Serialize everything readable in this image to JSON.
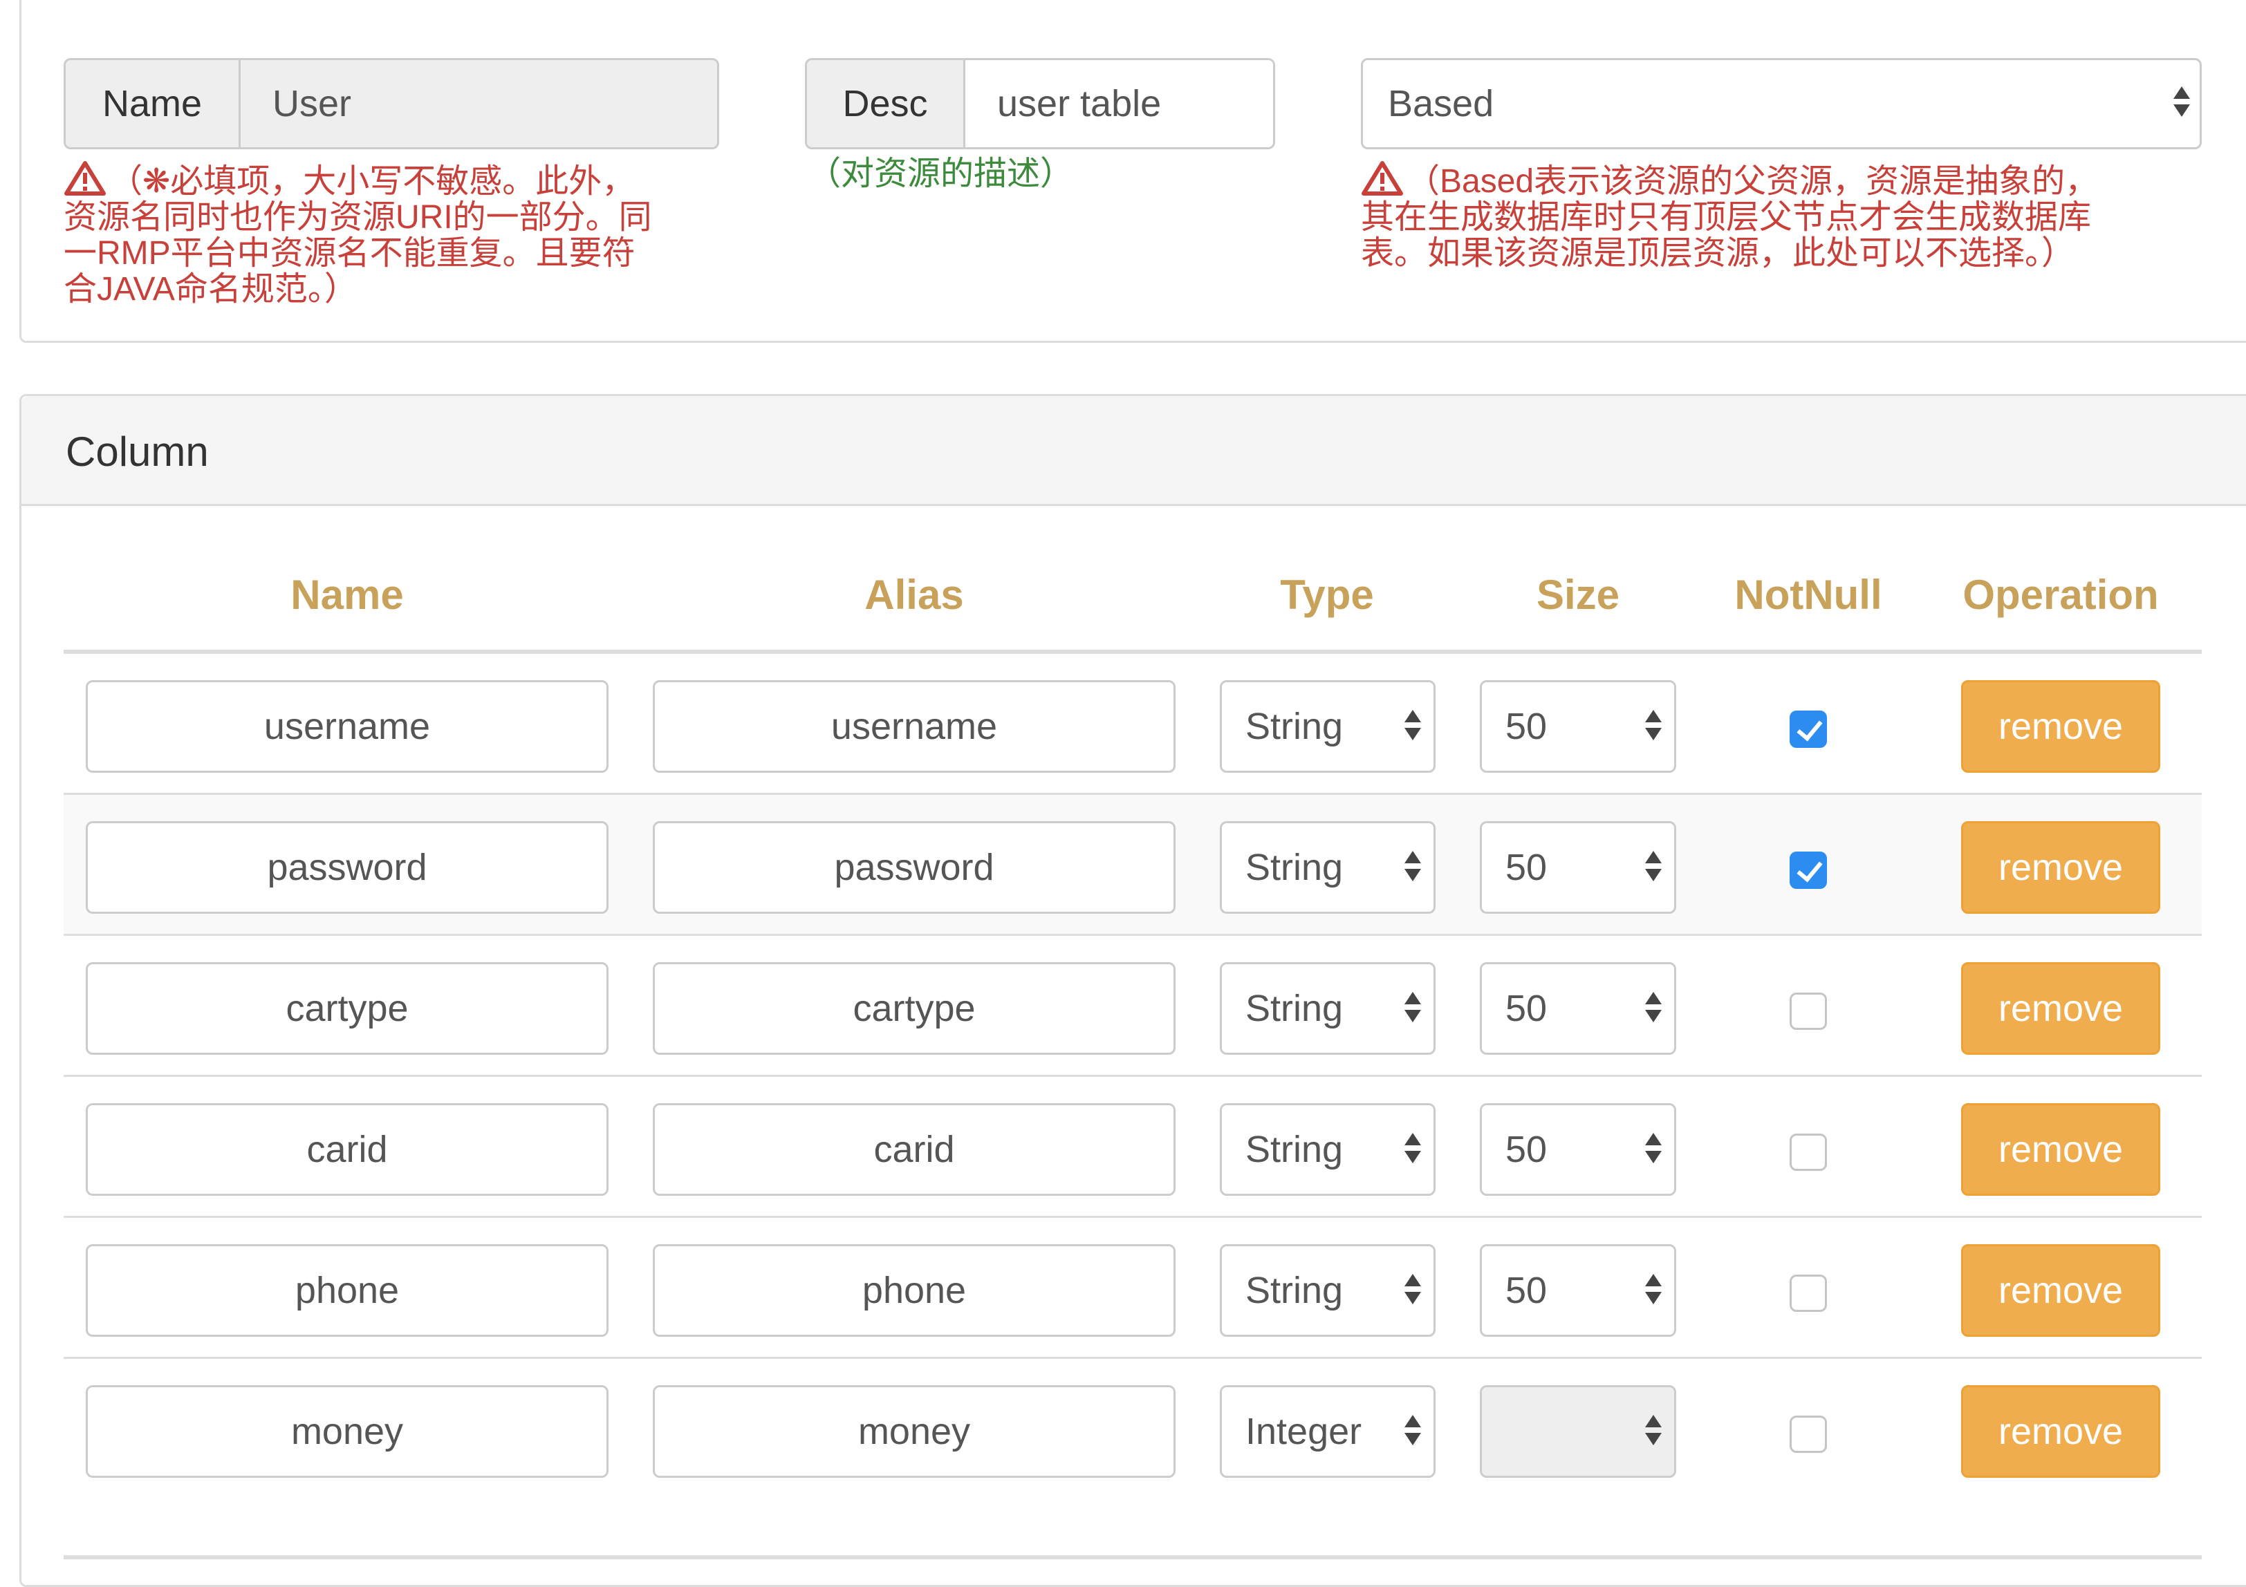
{
  "resource": {
    "name_label": "Name",
    "name_value": "User",
    "name_help": [
      "（❋必填项，大小写不敏感。此外，",
      "资源名同时也作为资源URI的一部分。同",
      "一RMP平台中资源名不能重复。且要符",
      "合JAVA命名规范。）"
    ],
    "desc_label": "Desc",
    "desc_value": "user table",
    "desc_help": "（对资源的描述）",
    "parent_value": "Based",
    "parent_help": [
      "（Based表示该资源的父资源，资源是抽象的，",
      "其在生成数据库时只有顶层父节点才会生成数据库",
      "表。如果该资源是顶层资源，此处可以不选择。）"
    ]
  },
  "column_panel": {
    "title": "Column",
    "headers": {
      "name": "Name",
      "alias": "Alias",
      "type": "Type",
      "size": "Size",
      "notnull": "NotNull",
      "operation": "Operation"
    },
    "remove_label": "remove",
    "rows": [
      {
        "name": "username",
        "alias": "username",
        "type": "String",
        "size": "50",
        "notnull": true
      },
      {
        "name": "password",
        "alias": "password",
        "type": "String",
        "size": "50",
        "notnull": true
      },
      {
        "name": "cartype",
        "alias": "cartype",
        "type": "String",
        "size": "50",
        "notnull": false
      },
      {
        "name": "carid",
        "alias": "carid",
        "type": "String",
        "size": "50",
        "notnull": false
      },
      {
        "name": "phone",
        "alias": "phone",
        "type": "String",
        "size": "50",
        "notnull": false
      },
      {
        "name": "money",
        "alias": "money",
        "type": "Integer",
        "size": "",
        "notnull": false
      }
    ]
  },
  "colors": {
    "header_text": "#c8a25a",
    "remove_button": "#f0ad4e",
    "checkbox_checked": "#2d8cf0",
    "help_error": "#c8403a",
    "help_info": "#3c8a3c"
  }
}
